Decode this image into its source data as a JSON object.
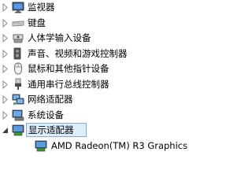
{
  "tree": {
    "categories": [
      {
        "label": "监视器",
        "icon": "monitor-icon",
        "expanded": false
      },
      {
        "label": "键盘",
        "icon": "keyboard-icon",
        "expanded": false
      },
      {
        "label": "人体学输入设备",
        "icon": "hid-icon",
        "expanded": false
      },
      {
        "label": "声音、视频和游戏控制器",
        "icon": "speaker-icon",
        "expanded": false
      },
      {
        "label": "鼠标和其他指针设备",
        "icon": "mouse-icon",
        "expanded": false
      },
      {
        "label": "通用串行总线控制器",
        "icon": "usb-icon",
        "expanded": false
      },
      {
        "label": "网络适配器",
        "icon": "network-adapter-icon",
        "expanded": false
      },
      {
        "label": "系统设备",
        "icon": "system-device-icon",
        "expanded": false
      },
      {
        "label": "显示适配器",
        "icon": "display-adapter-icon",
        "expanded": true,
        "selected": true
      }
    ],
    "children": [
      {
        "label": "AMD Radeon(TM) R3 Graphics",
        "icon": "display-adapter-icon"
      }
    ]
  }
}
